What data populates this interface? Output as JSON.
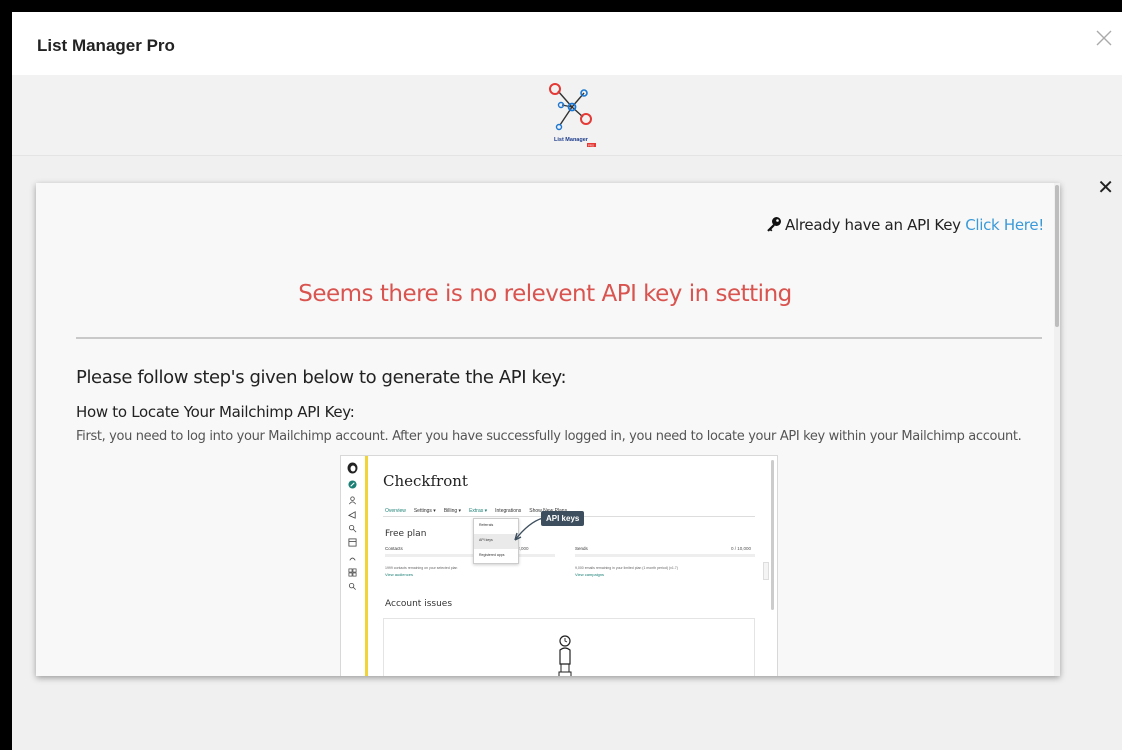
{
  "window": {
    "title": "List Manager Pro"
  },
  "logo": {
    "text": "List Manager",
    "badge": "PRO"
  },
  "notice": {
    "already_text": "Already have an API Key",
    "click_here": "Click Here!",
    "warning": "Seems there is no relevent API key in setting",
    "steps_heading": "Please follow step's given below to generate the API key:",
    "howto_heading": "How to Locate Your Mailchimp API Key:",
    "description": "First, you need to log into your Mailchimp account. After you have successfully logged in, you need to locate your API key within your Mailchimp account."
  },
  "screenshot": {
    "brand": "Checkfront",
    "nav": [
      "Overview",
      "Settings ▾",
      "Billing ▾",
      "Extras ▾",
      "Integrations",
      "Show New Plans"
    ],
    "plan": "Free plan",
    "contacts_label": "Contacts",
    "contacts_value": "1 / 2,000",
    "sends_label": "Sends",
    "sends_value": "0 / 10,000",
    "contacts_note": "1999 contacts remaining on your selected plan",
    "contacts_link": "View audiences",
    "sends_note": "9,000 emails remaining in your limited plan (1 month period) (v1.7)",
    "sends_link": "View campaigns",
    "issues": "Account issues",
    "menu": [
      "Referrals",
      "API keys",
      "Registered apps"
    ],
    "callout": "API keys"
  },
  "colors": {
    "warning": "#d9534f",
    "link": "#3a9ad9",
    "accent_yellow": "#f0d43a"
  }
}
